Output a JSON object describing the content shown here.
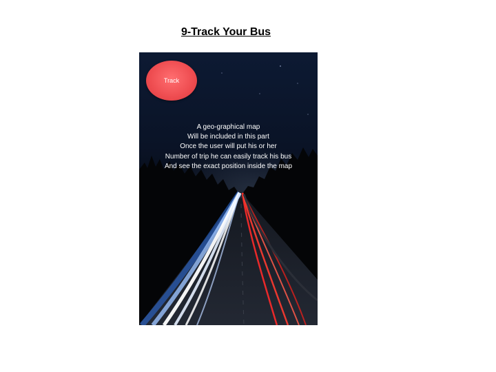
{
  "slide": {
    "title": "9-Track Your Bus"
  },
  "screen": {
    "background": "night highway light trails",
    "track_button": {
      "label": "Track",
      "color": "#EE4C50"
    },
    "description_lines": [
      "A geo-graphical map",
      "Will be included in this part",
      "Once the user will put his or her",
      "Number of trip he can easily track his bus",
      "And see the exact position inside the map"
    ]
  }
}
